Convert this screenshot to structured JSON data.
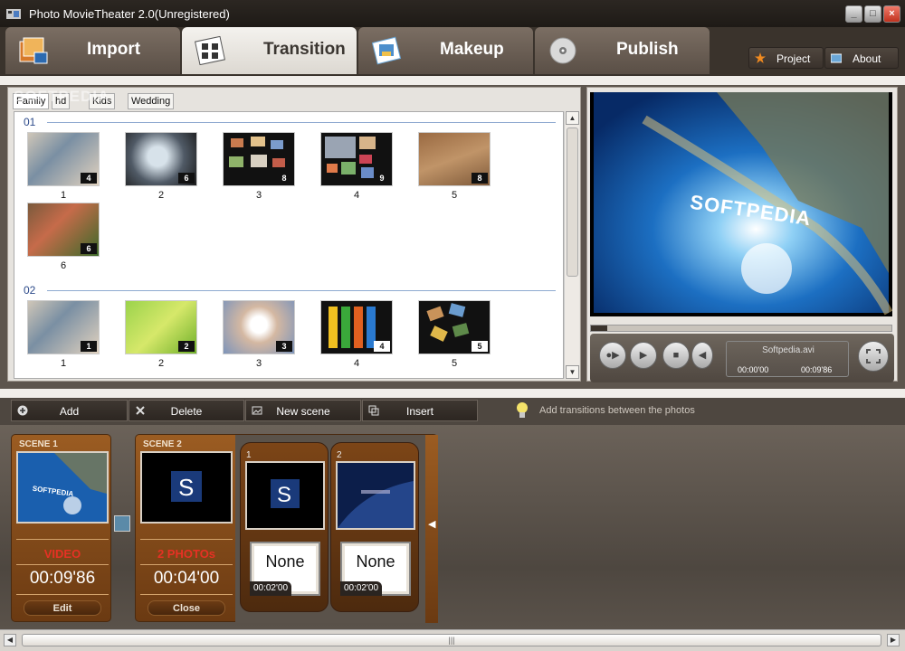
{
  "window": {
    "title": "Photo MovieTheater 2.0(Unregistered)"
  },
  "tabs": [
    {
      "label": "Import",
      "icon": "import-icon"
    },
    {
      "label": "Transition",
      "icon": "transition-icon"
    },
    {
      "label": "Makeup",
      "icon": "makeup-icon"
    },
    {
      "label": "Publish",
      "icon": "disc-icon"
    }
  ],
  "top_buttons": {
    "project_label": "Project",
    "about_label": "About"
  },
  "library": {
    "subtabs": [
      "Family",
      "hd",
      "Kids",
      "Wedding"
    ],
    "watermark": "SOFTPEDIA",
    "sections": [
      {
        "label": "01",
        "items": [
          {
            "num": "1",
            "badge": "4"
          },
          {
            "num": "2",
            "badge": "6"
          },
          {
            "num": "3",
            "badge": "8"
          },
          {
            "num": "4",
            "badge": "9"
          },
          {
            "num": "5",
            "badge": "8"
          },
          {
            "num": "6",
            "badge": "6"
          }
        ]
      },
      {
        "label": "02",
        "items": [
          {
            "num": "1",
            "badge": "1"
          },
          {
            "num": "2",
            "badge": "2"
          },
          {
            "num": "3",
            "badge": "3"
          },
          {
            "num": "4",
            "badge": "4"
          },
          {
            "num": "5",
            "badge": "5"
          }
        ]
      }
    ]
  },
  "preview": {
    "screen_text": "SOFTPEDIA",
    "filename": "Softpedia.avi",
    "time_start": "00:00'00",
    "time_end": "00:09'86"
  },
  "scene_toolbar": {
    "add_label": "Add",
    "delete_label": "Delete",
    "new_scene_label": "New scene",
    "insert_label": "Insert",
    "hint": "Add transitions between the photos"
  },
  "scenes": [
    {
      "title": "SCENE 1",
      "kind": "VIDEO",
      "duration": "00:09'86",
      "button": "Edit"
    },
    {
      "title": "SCENE 2",
      "kind": "2 PHOTOs",
      "duration": "00:04'00",
      "button": "Close"
    }
  ],
  "transitions": [
    {
      "num": "1",
      "label": "None",
      "duration": "00:02'00"
    },
    {
      "num": "2",
      "label": "None",
      "duration": "00:02'00"
    }
  ],
  "colors": {
    "accent": "#9b5c22",
    "video_kind": "#e63124",
    "section_blue": "#2c4a8a"
  }
}
